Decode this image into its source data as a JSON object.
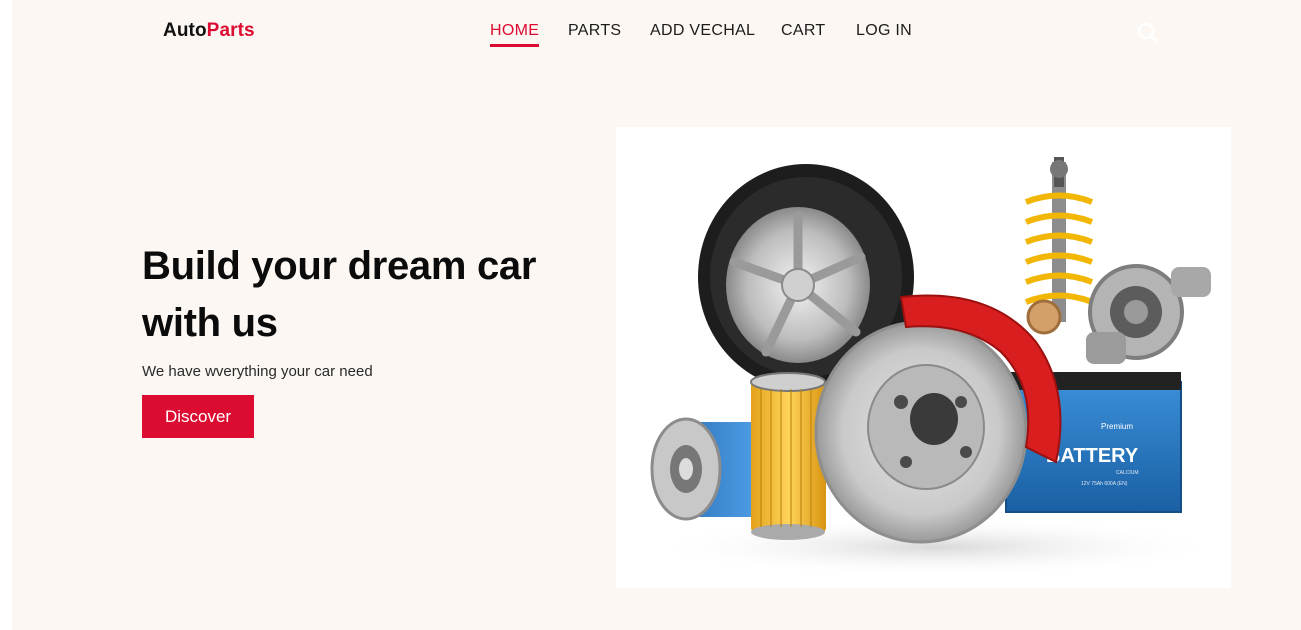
{
  "header": {
    "brand_part1": "Auto",
    "brand_part2": "Parts",
    "nav": [
      {
        "label": "HOME",
        "active": true
      },
      {
        "label": "PARTS",
        "active": false
      },
      {
        "label": "ADD VECHAL",
        "active": false
      },
      {
        "label": "CART",
        "active": false
      },
      {
        "label": "LOG IN",
        "active": false
      }
    ],
    "search_icon": "search-icon"
  },
  "hero": {
    "title": "Build your dream car with us",
    "subtitle": "We have wverything your car need",
    "button_label": "Discover",
    "image_battery_label": "BATTERY",
    "image_battery_brand": "Premium",
    "image_battery_spec": "12V 75Ah 600A (EN)",
    "image_battery_sub": "CALCIUM"
  },
  "colors": {
    "accent": "#dc0b32",
    "background": "#fcf7f2",
    "text": "#0b0b0b"
  }
}
